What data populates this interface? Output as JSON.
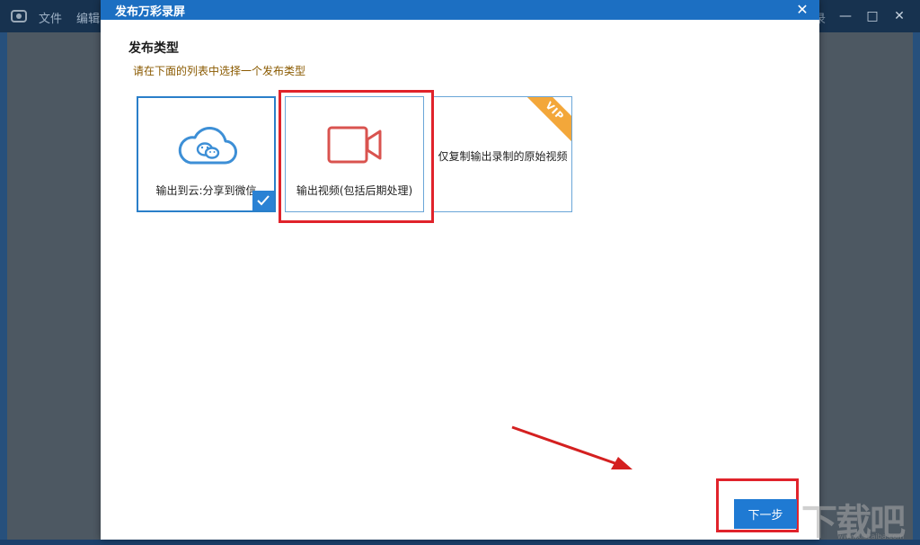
{
  "background_app": {
    "menu": [
      "文件",
      "编辑"
    ],
    "tail_text": "录",
    "window_buttons": [
      "—",
      "□",
      "✕"
    ]
  },
  "dialog": {
    "title": "发布万彩录屏",
    "close_label": "✕",
    "section_title": "发布类型",
    "hint": "请在下面的列表中选择一个发布类型",
    "options": [
      {
        "label": "输出到云:分享到微信",
        "selected": true,
        "icon": "cloud-icon"
      },
      {
        "label": "输出视频(包括后期处理)",
        "selected": false,
        "icon": "video-camera-icon"
      },
      {
        "label": "仅复制输出录制的原始视频",
        "selected": false,
        "badge": "VIP"
      }
    ],
    "next_label": "下一步"
  },
  "watermark": {
    "text": "下载吧",
    "sub": "www.xiazaiba.com"
  },
  "colors": {
    "header_blue": "#1c6fc2",
    "accent_blue": "#2a7fc9",
    "highlight_red": "#e0232b",
    "vip_orange": "#f3a73a",
    "video_icon_red": "#d9534f"
  }
}
